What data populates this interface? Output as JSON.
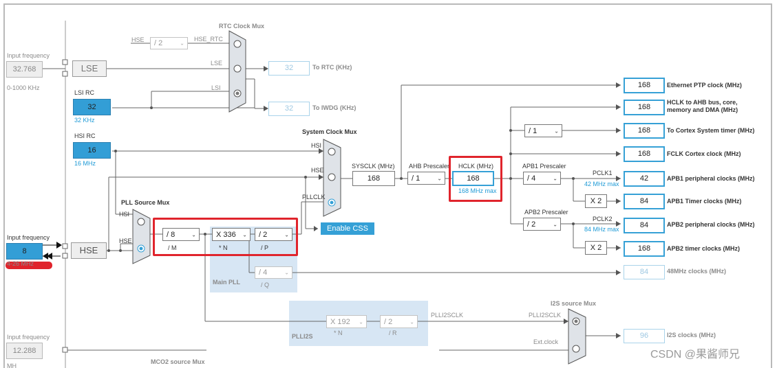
{
  "rtc_mux": {
    "title": "RTC Clock Mux",
    "hse_label": "HSE",
    "div_value": "/ 2",
    "hse_rtc_label": "HSE_RTC",
    "lse_label": "LSE",
    "lsi_label": "LSI",
    "rtc_value": "32",
    "rtc_label": "To RTC (KHz)",
    "iwdg_value": "32",
    "iwdg_label": "To IWDG (KHz)"
  },
  "lse": {
    "input_title": "Input frequency",
    "input_value": "32.768",
    "range": "0-1000 KHz",
    "block_label": "LSE"
  },
  "lsi": {
    "title": "LSI RC",
    "value": "32",
    "freq": "32 KHz"
  },
  "hsi": {
    "title": "HSI RC",
    "value": "16",
    "freq": "16 MHz"
  },
  "hse": {
    "input_title": "Input frequency",
    "input_value": "8",
    "range": "4-26 MHz",
    "block_label": "HSE"
  },
  "pll_source_mux": {
    "title": "PLL Source Mux",
    "hsi_label": "HSI",
    "hse_label": "HSE"
  },
  "main_pll": {
    "title": "Main PLL",
    "m_value": "/ 8",
    "m_label": "/ M",
    "n_value": "X 336",
    "n_label": "* N",
    "p_value": "/ 2",
    "p_label": "/ P",
    "q_value": "/ 4",
    "q_label": "/ Q"
  },
  "system_mux": {
    "title": "System Clock Mux",
    "hsi_label": "HSI",
    "hse_label": "HSE",
    "pllclk_label": "PLLCLK",
    "enable_css": "Enable CSS"
  },
  "sysclk": {
    "label": "SYSCLK (MHz)",
    "value": "168"
  },
  "ahb": {
    "label": "AHB Prescaler",
    "value": "/ 1"
  },
  "hclk": {
    "label": "HCLK (MHz)",
    "value": "168",
    "max": "168 MHz max"
  },
  "apb1": {
    "label": "APB1 Prescaler",
    "value": "/ 4",
    "pclk_label": "PCLK1",
    "pclk_max": "42 MHz max",
    "timer_mult": "X 2"
  },
  "apb2": {
    "label": "APB2 Prescaler",
    "value": "/ 2",
    "pclk_label": "PCLK2",
    "pclk_max": "84 MHz max",
    "timer_mult": "X 2"
  },
  "cortex_div": {
    "value": "/ 1"
  },
  "outputs": [
    {
      "value": "168",
      "label": "Ethernet PTP clock (MHz)"
    },
    {
      "value": "168",
      "label": "HCLK to AHB bus, core, memory and DMA (MHz)"
    },
    {
      "value": "168",
      "label": "To Cortex System timer (MHz)"
    },
    {
      "value": "168",
      "label": "FCLK Cortex clock (MHz)"
    },
    {
      "value": "42",
      "label": "APB1 peripheral clocks (MHz)"
    },
    {
      "value": "84",
      "label": "APB1 Timer clocks (MHz)"
    },
    {
      "value": "84",
      "label": "APB2 peripheral clocks (MHz)"
    },
    {
      "value": "168",
      "label": "APB2 timer clocks (MHz)"
    },
    {
      "value": "84",
      "label": "48MHz clocks (MHz)"
    }
  ],
  "plli2s": {
    "title": "PLLI2S",
    "n_value": "X 192",
    "n_label": "* N",
    "r_value": "/ 2",
    "r_label": "/ R",
    "clk_label": "PLLI2SCLK"
  },
  "i2s_mux": {
    "title": "I2S source Mux",
    "plli2sclk_label": "PLLI2SCLK",
    "ext_label": "Ext.clock",
    "value": "96",
    "label": "I2S clocks (MHz)"
  },
  "i2s_input": {
    "title": "Input frequency",
    "value": "12.288",
    "unit": "MH"
  },
  "mco2": {
    "title": "MCO2 source Mux"
  },
  "watermark": "CSDN @果酱师兄"
}
